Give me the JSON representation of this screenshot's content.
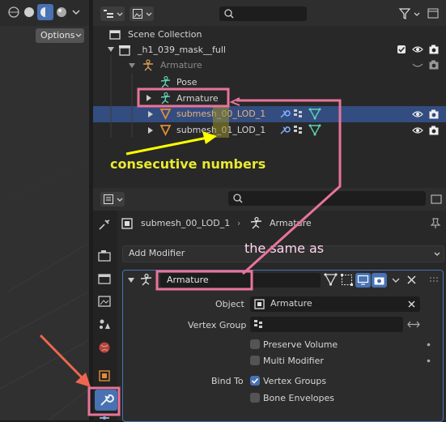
{
  "viewport": {
    "options_label": "Options"
  },
  "outliner": {
    "search_placeholder": "",
    "scene_collection": "Scene Collection",
    "collection": "_h1_039_mask__full",
    "armature_parent": "Armature",
    "pose": "Pose",
    "armature_child": "Armature",
    "submesh0": "submesh_00_LOD_1",
    "submesh1": "submesh_01_LOD_1"
  },
  "properties": {
    "search_placeholder": "",
    "breadcrumb_object": "submesh_00_LOD_1",
    "breadcrumb_sep": "›",
    "breadcrumb_modifier": "Armature",
    "add_modifier": "Add Modifier",
    "modifier_name": "Armature",
    "object_label": "Object",
    "object_value": "Armature",
    "vertex_group_label": "Vertex Group",
    "vertex_group_value": "",
    "preserve_volume": "Preserve Volume",
    "multi_modifier": "Multi Modifier",
    "bind_to_label": "Bind To",
    "vertex_groups": "Vertex Groups",
    "bone_envelopes": "Bone Envelopes"
  },
  "annotations": {
    "consecutive": "consecutive numbers",
    "same_as": "the same as"
  },
  "colors": {
    "highlight_pink": "#e8749a",
    "arrow_yellow": "#ffff00",
    "selected_row": "#334d80",
    "armature_green": "#5fd1b4",
    "mesh_orange": "#e38a3a",
    "accent_blue": "#4772b3"
  }
}
